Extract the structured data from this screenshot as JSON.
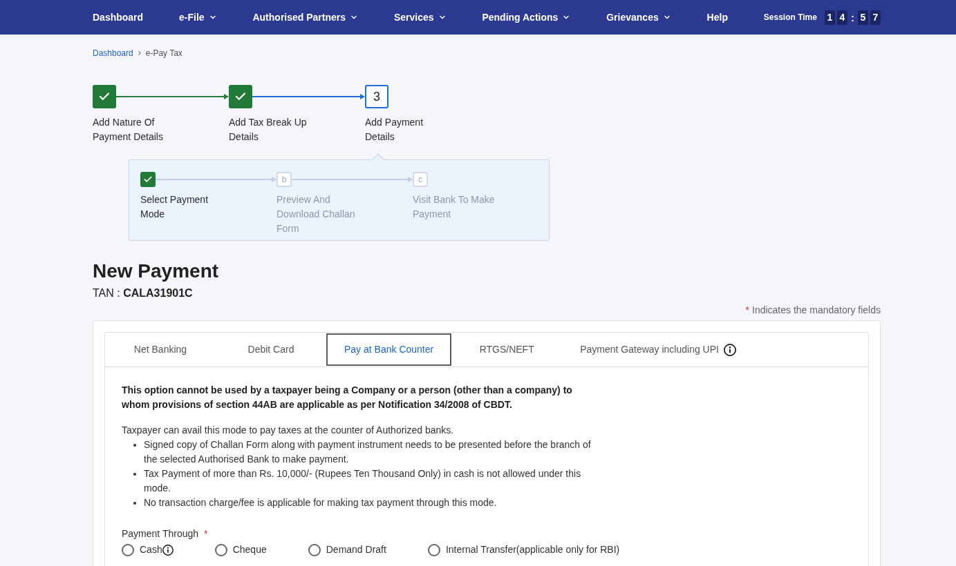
{
  "nav": {
    "items": [
      {
        "label": "Dashboard",
        "dropdown": false
      },
      {
        "label": "e-File",
        "dropdown": true
      },
      {
        "label": "Authorised Partners",
        "dropdown": true
      },
      {
        "label": "Services",
        "dropdown": true
      },
      {
        "label": "Pending Actions",
        "dropdown": true
      },
      {
        "label": "Grievances",
        "dropdown": true
      },
      {
        "label": "Help",
        "dropdown": false
      }
    ],
    "session_time": {
      "label": "Session Time",
      "hours": [
        "1",
        "4"
      ],
      "separator": ":",
      "minutes": [
        "5",
        "7"
      ]
    }
  },
  "breadcrumb": [
    {
      "label": "Dashboard",
      "link": true
    },
    {
      "label": "e-Pay Tax",
      "link": false
    }
  ],
  "steps": [
    {
      "kind": "done",
      "label": "Add Nature Of Payment Details"
    },
    {
      "kind": "done",
      "label": "Add Tax Break Up Details"
    },
    {
      "kind": "current",
      "number": "3",
      "label": "Add Payment Details"
    }
  ],
  "sub_steps": [
    {
      "kind": "done",
      "label": "Select Payment Mode"
    },
    {
      "kind": "pending",
      "letter": "b",
      "label": "Preview And Download Challan Form"
    },
    {
      "kind": "pending",
      "letter": "c",
      "label": "Visit Bank To Make Payment"
    }
  ],
  "page": {
    "title": "New Payment",
    "tan": "TAN : **CALA31901C**",
    "mandatory_mark": "*",
    "mandatory_note": "Indicates the mandatory fields"
  },
  "tabs": [
    {
      "label": "Net Banking",
      "selected": false,
      "info": false
    },
    {
      "label": "Debit Card",
      "selected": false,
      "info": false
    },
    {
      "label": "Pay at Bank Counter",
      "selected": true,
      "info": false
    },
    {
      "label": "RTGS/NEFT",
      "selected": false,
      "info": false
    },
    {
      "label": "Payment Gateway including UPI",
      "selected": false,
      "info": true
    }
  ],
  "panel": {
    "warning": "This option cannot be used by a taxpayer being a Company or a person (other than a company) to whom provisions of section 44AB are applicable as per Notification 34/2008 of CBDT.",
    "intro": "Taxpayer can avail this mode to pay taxes at the counter of Authorized banks.",
    "bullets": [
      "Signed copy of Challan Form along with payment instrument needs to be presented before the branch of the selected Authorised Bank to make payment.",
      "Tax Payment of more than Rs. 10,000/- (Rupees Ten Thousand Only) in cash is not allowed under this mode.",
      "No transaction charge/fee is applicable for making tax payment through this mode."
    ]
  },
  "payment_through": {
    "label": "Payment Through",
    "required_mark": "*",
    "options": [
      {
        "label": "Cash",
        "selected": false,
        "info": true
      },
      {
        "label": "Cheque",
        "selected": false,
        "info": false
      },
      {
        "label": "Demand Draft",
        "selected": false,
        "info": false
      },
      {
        "label": "Internal Transfer(applicable only for RBI)",
        "selected": false,
        "info": false
      }
    ]
  }
}
